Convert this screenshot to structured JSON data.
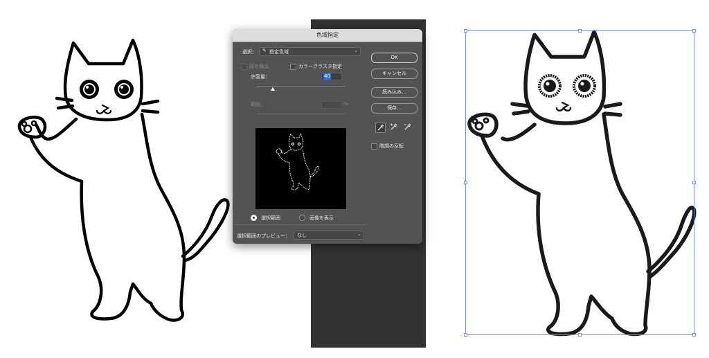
{
  "dialog": {
    "title": "色域指定",
    "select_label": "選択：",
    "select_value": "指定色域",
    "detect_faces_label": "顔を検出",
    "color_cluster_label": "カラークラスタ指定",
    "tolerance_label": "許容量：",
    "tolerance_value": "40",
    "range_label": "範囲：",
    "range_unit": "%",
    "view_selection_label": "選択範囲",
    "view_image_label": "画像を表示",
    "preview_label": "選択範囲のプレビュー：",
    "preview_value": "なし",
    "buttons": {
      "ok": "OK",
      "cancel": "キャンセル",
      "load": "読み込み...",
      "save": "保存..."
    },
    "invert_label": "階調の反転",
    "selected_view": "selection",
    "tolerance_fraction": 0.2
  },
  "icons": {
    "eyedropper": "eyedropper-icon",
    "eyedropper_plus": "eyedropper-plus-icon",
    "eyedropper_minus": "eyedropper-minus-icon"
  },
  "colors": {
    "dialog_bg": "#535353",
    "selection_box": "#7b8fd6"
  }
}
